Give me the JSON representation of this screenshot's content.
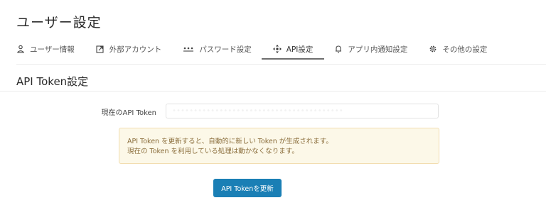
{
  "page": {
    "title": "ユーザー設定"
  },
  "tabs": [
    {
      "label": "ユーザー情報",
      "icon": "user-icon"
    },
    {
      "label": "外部アカウント",
      "icon": "external-link-icon"
    },
    {
      "label": "パスワード設定",
      "icon": "password-icon"
    },
    {
      "label": "API設定",
      "icon": "move-arrows-icon",
      "active": true
    },
    {
      "label": "アプリ内通知設定",
      "icon": "bell-icon"
    },
    {
      "label": "その他の設定",
      "icon": "gear-icon"
    }
  ],
  "section": {
    "title": "API Token設定"
  },
  "token": {
    "label": "現在のAPI Token",
    "value": "••••••••••••••••••••••••••••••••••••••••"
  },
  "notice": {
    "line1": "API Token を更新すると、自動的に新しい Token が生成されます。",
    "line2": "現在の Token を利用している処理は動かなくなります。"
  },
  "actions": {
    "update_label": "API Tokenを更新"
  },
  "colors": {
    "primary": "#1a7fb5",
    "warning_bg": "#fcf8e8",
    "warning_text": "#8a6d3b"
  }
}
